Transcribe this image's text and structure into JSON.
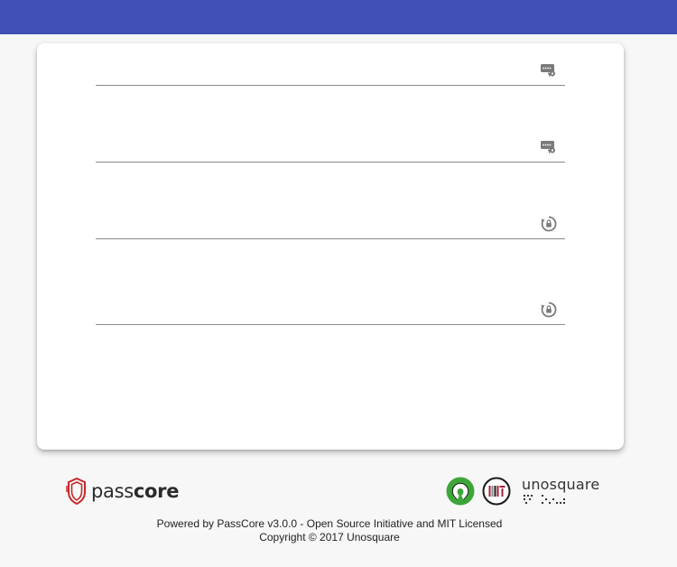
{
  "app": {
    "brand_left": "passcore",
    "brand_right": "unosquare"
  },
  "form": {
    "fields": [
      {
        "name": "username",
        "value": "",
        "placeholder": "",
        "icon": "password-field-icon"
      },
      {
        "name": "current-password",
        "value": "",
        "placeholder": "",
        "icon": "password-field-icon"
      },
      {
        "name": "new-password",
        "value": "",
        "placeholder": "",
        "icon": "lock-reset-icon"
      },
      {
        "name": "confirm-new-password",
        "value": "",
        "placeholder": "",
        "icon": "lock-reset-icon"
      }
    ]
  },
  "footer": {
    "powered_by": "Powered by PassCore v3.0.0 - Open Source Initiative and MIT Licensed",
    "copyright": "Copyright © 2017 Unosquare",
    "logos": [
      "passcore-logo",
      "osi-logo",
      "mit-logo",
      "unosquare-logo"
    ]
  },
  "colors": {
    "appbar": "#3f51b5",
    "background": "#f7f7f7",
    "card": "#ffffff",
    "osi_green": "#3da639",
    "passcore_red": "#c62828"
  }
}
